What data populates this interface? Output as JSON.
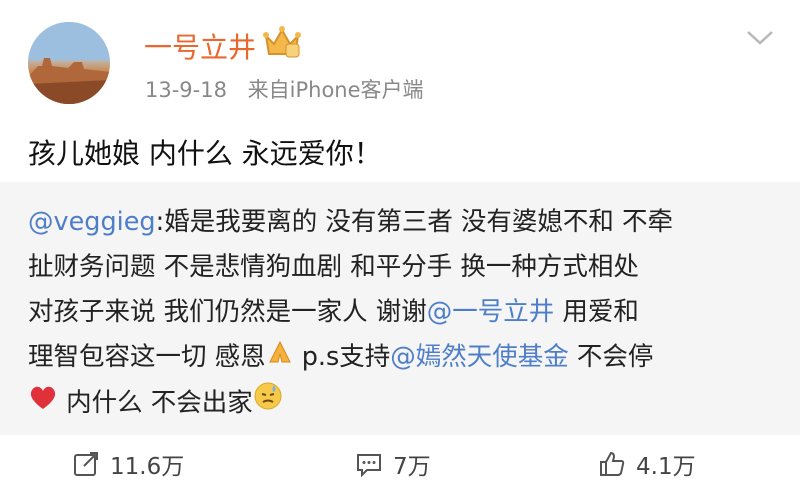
{
  "post": {
    "username": "一号立井",
    "date": "13-9-18",
    "source": "来自iPhone客户端",
    "text": "孩儿她娘 内什么 永远爱你！"
  },
  "repost": {
    "mention_author": "@veggieg",
    "line1_rest": ":婚是我要离的 没有第三者 没有婆媳不和 不牵",
    "line2": "扯财务问题 不是悲情狗血剧 和平分手 换一种方式相处",
    "line3_a": "对孩子来说 我们仍然是一家人 谢谢",
    "mention_user": "@一号立井",
    "line3_b": " 用爱和",
    "line4_a": "理智包容这一切 感恩",
    "line4_b": " p.s支持",
    "mention_fund": "@嫣然天使基金",
    "line4_c": " 不会停",
    "line5_a": " 内什么 不会出家"
  },
  "actions": {
    "repost_count": "11.6万",
    "comment_count": "7万",
    "like_count": "4.1万"
  },
  "icons": [
    "crown-badge-icon",
    "chevron-down-icon",
    "pray-emoji-icon",
    "heart-emoji-icon",
    "sweat-emoji-icon",
    "repost-icon",
    "comment-icon",
    "like-icon"
  ],
  "colors": {
    "username": "#e8682d",
    "mention": "#4f7ec8",
    "meta": "#888888"
  }
}
